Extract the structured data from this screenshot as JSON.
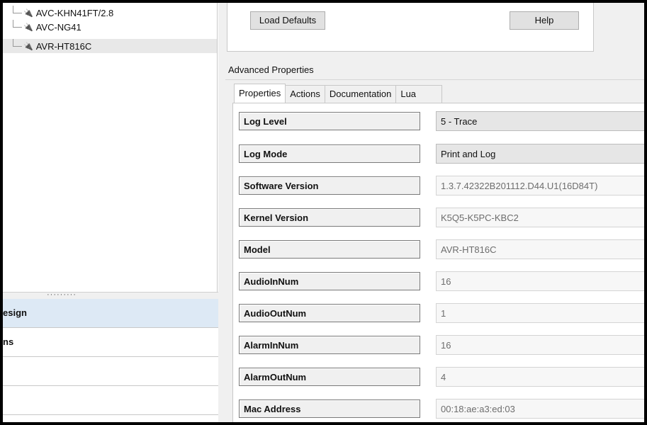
{
  "tree": {
    "items": [
      {
        "label": "AVC-KHN41FT/2.8",
        "selected": false
      },
      {
        "label": "AVC-NG41",
        "selected": false
      },
      {
        "label": "AVR-HT816C",
        "selected": true
      }
    ]
  },
  "splitter": {
    "grip": "·········"
  },
  "nav": {
    "items": [
      {
        "label": "esign",
        "active": true
      },
      {
        "label": "ns",
        "active": false
      },
      {
        "label": "",
        "active": false
      },
      {
        "label": "",
        "active": false
      }
    ]
  },
  "toolbar": {
    "load_defaults": "Load Defaults",
    "help": "Help"
  },
  "advanced": {
    "title": "Advanced Properties",
    "tabs": [
      "Properties",
      "Actions",
      "Documentation",
      "Lua"
    ],
    "active_tab": "Properties"
  },
  "properties": [
    {
      "label": "Log Level",
      "value": "5 - Trace",
      "editable": true
    },
    {
      "label": "Log Mode",
      "value": "Print and Log",
      "editable": true
    },
    {
      "label": "Software Version",
      "value": "1.3.7.42322B201112.D44.U1(16D84T)",
      "editable": false
    },
    {
      "label": "Kernel Version",
      "value": "K5Q5-K5PC-KBC2",
      "editable": false
    },
    {
      "label": "Model",
      "value": "AVR-HT816C",
      "editable": false
    },
    {
      "label": "AudioInNum",
      "value": "16",
      "editable": false
    },
    {
      "label": "AudioOutNum",
      "value": "1",
      "editable": false
    },
    {
      "label": "AlarmInNum",
      "value": "16",
      "editable": false
    },
    {
      "label": "AlarmOutNum",
      "value": "4",
      "editable": false
    },
    {
      "label": "Mac Address",
      "value": "00:18:ae:a3:ed:03",
      "editable": false
    }
  ]
}
